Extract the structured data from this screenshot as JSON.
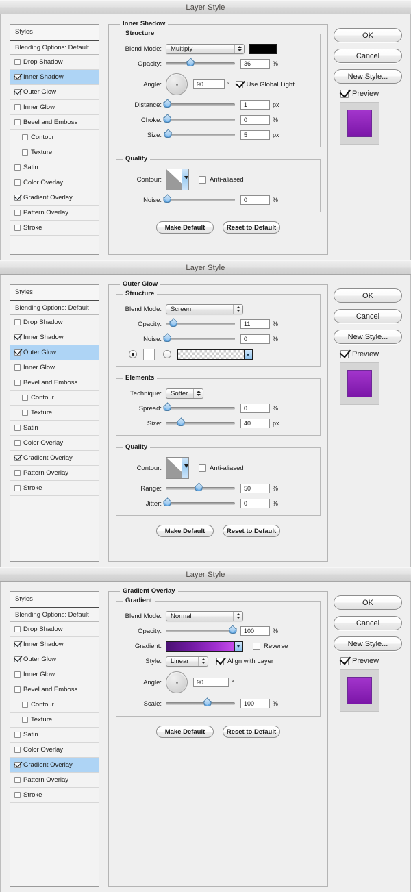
{
  "window_title": "Layer Style",
  "colors": {
    "selection": "#aed4f5",
    "shadow_color": "#000000",
    "gradient_start": "#4a1273",
    "gradient_end": "#c64cea",
    "preview_fill_top": "#9c27c4",
    "preview_fill_bottom": "#7b16a8"
  },
  "sidebar": {
    "header": "Styles",
    "blending_options": "Blending Options: Default",
    "items": [
      {
        "label": "Drop Shadow",
        "checked": false,
        "indent": false
      },
      {
        "label": "Inner Shadow",
        "checked": true,
        "indent": false
      },
      {
        "label": "Outer Glow",
        "checked": true,
        "indent": false
      },
      {
        "label": "Inner Glow",
        "checked": false,
        "indent": false
      },
      {
        "label": "Bevel and Emboss",
        "checked": false,
        "indent": false
      },
      {
        "label": "Contour",
        "checked": false,
        "indent": true
      },
      {
        "label": "Texture",
        "checked": false,
        "indent": true
      },
      {
        "label": "Satin",
        "checked": false,
        "indent": false
      },
      {
        "label": "Color Overlay",
        "checked": false,
        "indent": false
      },
      {
        "label": "Gradient Overlay",
        "checked": true,
        "indent": false
      },
      {
        "label": "Pattern Overlay",
        "checked": false,
        "indent": false
      },
      {
        "label": "Stroke",
        "checked": false,
        "indent": false
      }
    ]
  },
  "buttons": {
    "ok": "OK",
    "cancel": "Cancel",
    "new_style": "New Style...",
    "preview": "Preview",
    "make_default": "Make Default",
    "reset_to_default": "Reset to Default"
  },
  "labels": {
    "blend_mode": "Blend Mode:",
    "opacity": "Opacity:",
    "angle": "Angle:",
    "distance": "Distance:",
    "choke": "Choke:",
    "size": "Size:",
    "contour": "Contour:",
    "noise": "Noise:",
    "technique": "Technique:",
    "spread": "Spread:",
    "range": "Range:",
    "jitter": "Jitter:",
    "gradient": "Gradient:",
    "style": "Style:",
    "scale": "Scale:",
    "use_global_light": "Use Global Light",
    "anti_aliased": "Anti-aliased",
    "reverse": "Reverse",
    "align_with_layer": "Align with Layer",
    "structure": "Structure",
    "quality": "Quality",
    "elements": "Elements",
    "gradient_group": "Gradient",
    "pct": "%",
    "px": "px",
    "deg": "°"
  },
  "panels": [
    {
      "selected_effect": "Inner Shadow",
      "section_title": "Inner Shadow",
      "blend_mode": "Multiply",
      "opacity": "36",
      "angle": "90",
      "use_global_light": true,
      "distance": "1",
      "choke": "0",
      "size": "5",
      "anti_aliased": false,
      "noise": "0",
      "sliders": {
        "opacity": 36,
        "distance": 2,
        "choke": 2,
        "size": 3,
        "noise": 2
      }
    },
    {
      "selected_effect": "Outer Glow",
      "section_title": "Outer Glow",
      "blend_mode": "Screen",
      "opacity": "11",
      "noise": "0",
      "fill_mode": "color",
      "technique": "Softer",
      "spread": "0",
      "size": "40",
      "anti_aliased": false,
      "range": "50",
      "jitter": "0",
      "sliders": {
        "opacity": 11,
        "noise": 2,
        "spread": 2,
        "size": 22,
        "range": 50,
        "jitter": 2
      }
    },
    {
      "selected_effect": "Gradient Overlay",
      "section_title": "Gradient Overlay",
      "blend_mode": "Normal",
      "opacity": "100",
      "reverse": false,
      "style": "Linear",
      "align_with_layer": true,
      "angle": "90",
      "scale": "100",
      "sliders": {
        "opacity": 100,
        "scale": 60
      }
    }
  ]
}
